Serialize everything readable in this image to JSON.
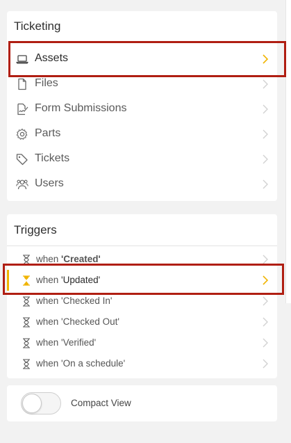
{
  "ticketing": {
    "title": "Ticketing",
    "items": [
      {
        "label": "Assets",
        "icon": "laptop-icon",
        "active": true
      },
      {
        "label": "Files",
        "icon": "file-icon"
      },
      {
        "label": "Form Submissions",
        "icon": "form-signature-icon"
      },
      {
        "label": "Parts",
        "icon": "gear-icon"
      },
      {
        "label": "Tickets",
        "icon": "tag-icon"
      },
      {
        "label": "Users",
        "icon": "users-icon"
      }
    ]
  },
  "triggers": {
    "title": "Triggers",
    "items": [
      {
        "prefix": "when ",
        "value": "'Created'"
      },
      {
        "prefix": "when ",
        "value": "'Updated'",
        "active": true
      },
      {
        "prefix": "when ",
        "value": "'Checked In'"
      },
      {
        "prefix": "when ",
        "value": "'Checked Out'"
      },
      {
        "prefix": "when ",
        "value": "'Verified'"
      },
      {
        "prefix": "when ",
        "value": "'On a schedule'"
      }
    ]
  },
  "compact_view": {
    "label": "Compact View",
    "enabled": false
  },
  "colors": {
    "accent": "#f0b400",
    "highlight_box": "#b01e12",
    "chevron": "#cfcfcf"
  }
}
